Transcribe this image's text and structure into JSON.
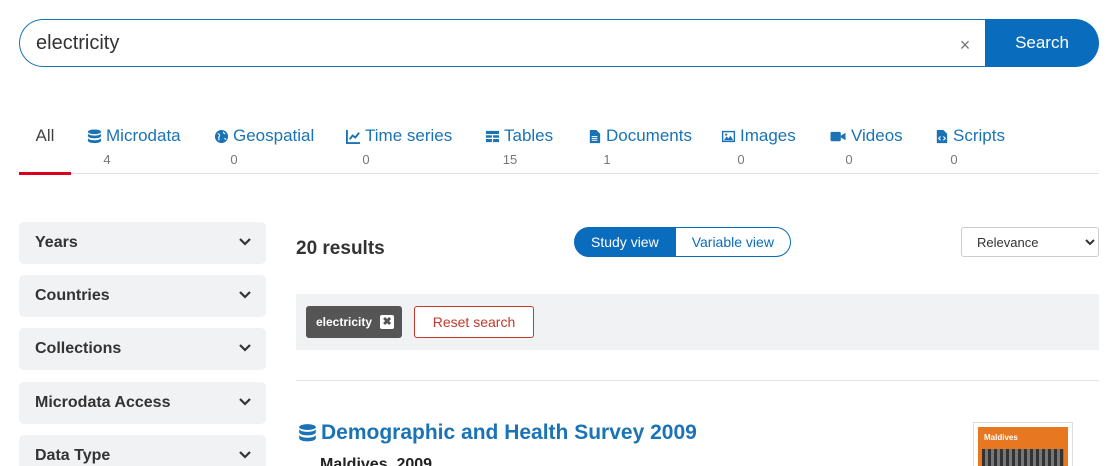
{
  "search": {
    "value": "electricity",
    "clear_glyph": "×",
    "button_label": "Search"
  },
  "tabs": [
    {
      "label": "All",
      "count": "",
      "icon": "none",
      "active": true
    },
    {
      "label": "Microdata",
      "count": "4",
      "icon": "database-icon"
    },
    {
      "label": "Geospatial",
      "count": "0",
      "icon": "globe-icon"
    },
    {
      "label": "Time series",
      "count": "0",
      "icon": "line-chart-icon"
    },
    {
      "label": "Tables",
      "count": "15",
      "icon": "table-icon"
    },
    {
      "label": "Documents",
      "count": "1",
      "icon": "document-icon"
    },
    {
      "label": "Images",
      "count": "0",
      "icon": "image-icon"
    },
    {
      "label": "Videos",
      "count": "0",
      "icon": "video-icon"
    },
    {
      "label": "Scripts",
      "count": "0",
      "icon": "script-file-icon"
    }
  ],
  "facets": [
    {
      "label": "Years"
    },
    {
      "label": "Countries"
    },
    {
      "label": "Collections"
    },
    {
      "label": "Microdata Access"
    },
    {
      "label": "Data Type"
    }
  ],
  "results": {
    "count_label": "20 results",
    "view_toggle": {
      "study": "Study view",
      "variable": "Variable view"
    },
    "sort": {
      "selected": "Relevance"
    }
  },
  "filters": {
    "keyword": "electricity",
    "remove_glyph": "✖",
    "reset_label": "Reset search"
  },
  "result_item": {
    "title": "Demographic and Health Survey 2009",
    "subtitle": "Maldives, 2009",
    "thumbnail_text": "Maldives"
  },
  "colors": {
    "accent": "#0a6cbc",
    "link": "#1a73b5",
    "active_tab_bar": "#d9001b",
    "reset": "#c0392b",
    "chip": "#555555",
    "facet_bg": "#f1f2f4"
  }
}
